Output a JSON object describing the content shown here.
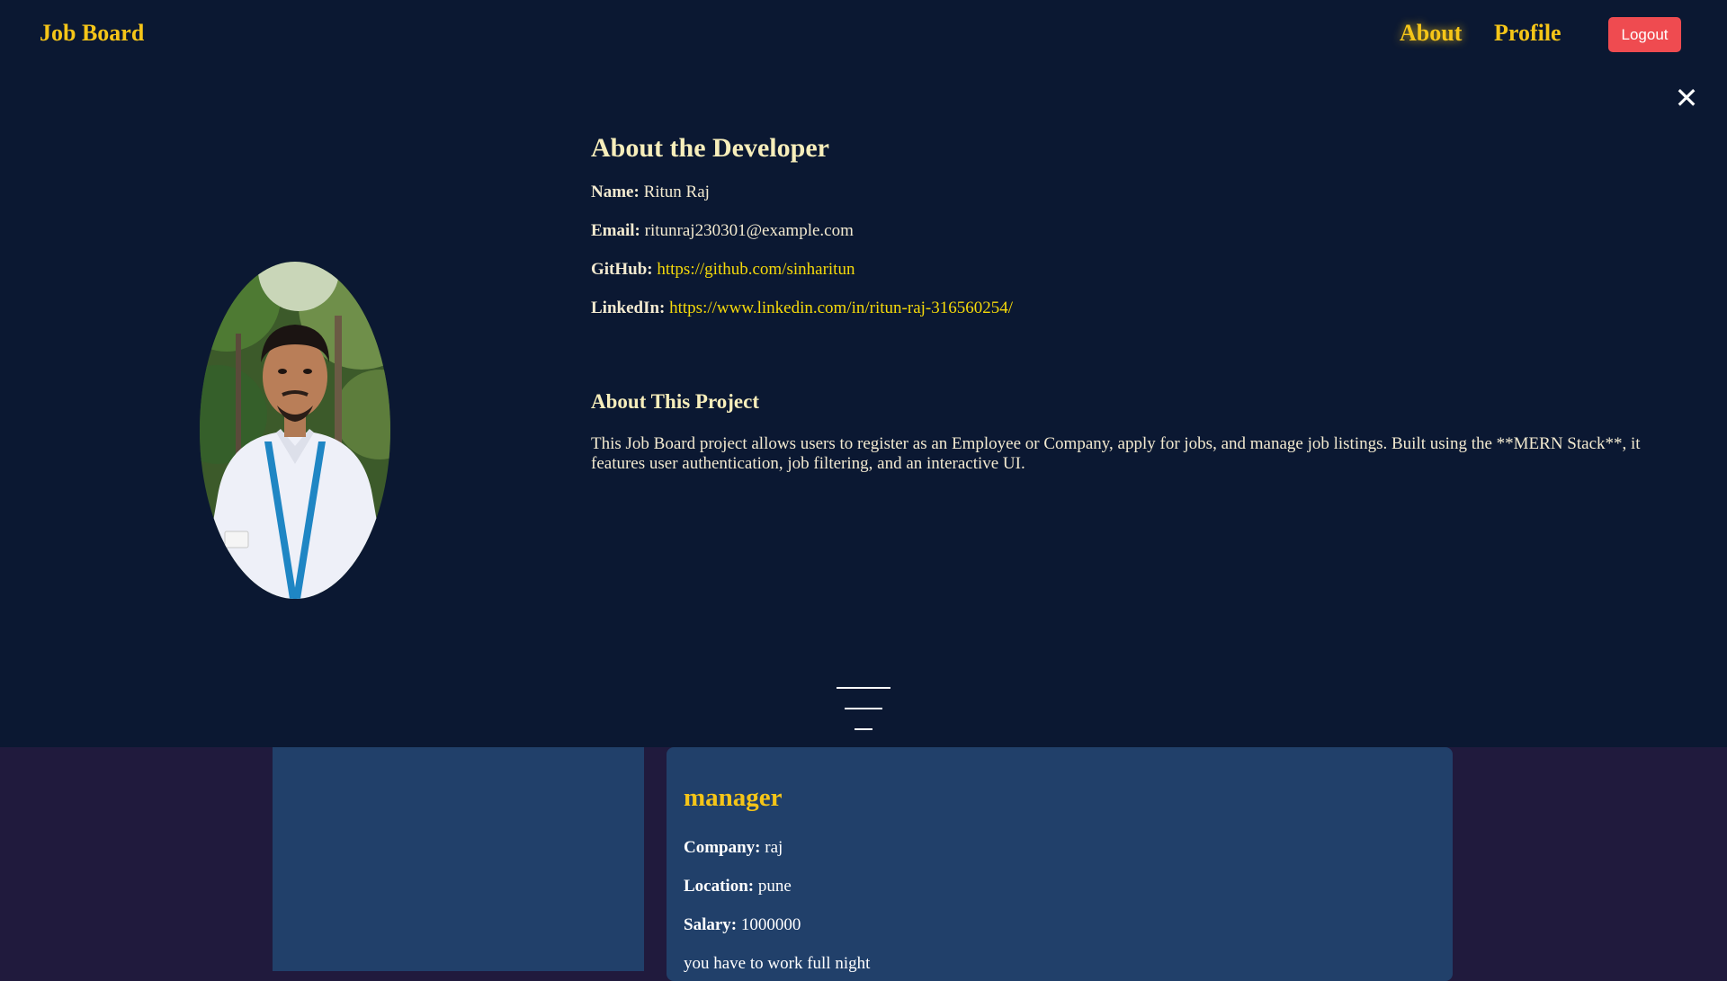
{
  "navbar": {
    "brand": "Job Board",
    "links": {
      "about": "About",
      "profile": "Profile"
    },
    "logout_label": "Logout"
  },
  "modal": {
    "close_icon": "✕",
    "developer": {
      "title": "About the Developer",
      "name_label": "Name:",
      "name_value": "Ritun Raj",
      "email_label": "Email:",
      "email_value": "ritunraj230301@example.com",
      "github_label": "GitHub:",
      "github_value": "https://github.com/sinharitun",
      "linkedin_label": "LinkedIn:",
      "linkedin_value": "https://www.linkedin.com/in/ritun-raj-316560254/"
    },
    "project": {
      "title": "About This Project",
      "description": "This Job Board project allows users to register as an Employee or Company, apply for jobs, and manage job listings. Built using the **MERN Stack**, it features user authentication, job filtering, and an interactive UI."
    }
  },
  "job_card": {
    "title": "manager",
    "company_label": "Company:",
    "company_value": "raj",
    "location_label": "Location:",
    "location_value": "pune",
    "salary_label": "Salary:",
    "salary_value": "1000000",
    "description": "you have to work full night"
  },
  "colors": {
    "navbar_bg": "#0b1832",
    "accent_gold": "#f5c518",
    "link_yellow": "#f5d90a",
    "logout_red": "#ef4b50",
    "card_bg": "#21406a",
    "page_bg": "#201a3d"
  }
}
